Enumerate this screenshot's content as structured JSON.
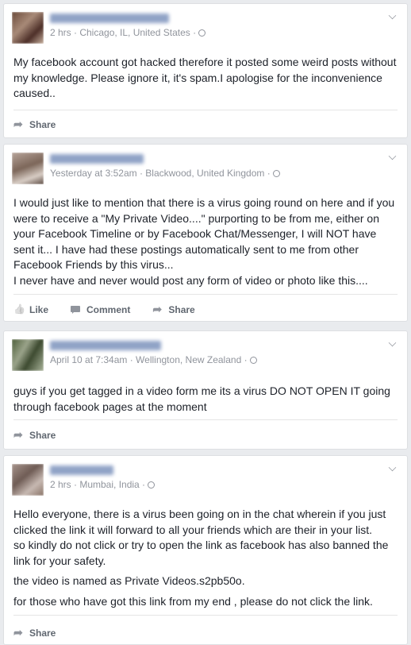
{
  "posts": [
    {
      "meta": "2 hrs · Chicago, IL, United States ·",
      "body": [
        "My facebook account got hacked therefore it posted some weird posts without my knowledge. Please ignore it, it's spam.I apologise for the inconvenience caused.."
      ],
      "actions": {
        "share": "Share"
      }
    },
    {
      "meta": "Yesterday at 3:52am · Blackwood, United Kingdom ·",
      "body": [
        "I would just like to mention that there is a virus going round on here and if you were to receive a \"My Private Video....\" purporting to be from me, either on your Facebook Timeline or by Facebook Chat/Messenger, I will NOT have sent it... I have had these postings automatically sent to me from other Facebook Friends by this virus...",
        "I never have and never would post any form of video or photo like this...."
      ],
      "actions": {
        "like": "Like",
        "comment": "Comment",
        "share": "Share"
      }
    },
    {
      "meta": "April 10 at 7:34am · Wellington, New Zealand ·",
      "body": [
        "guys if you get tagged in a video form me its a virus DO NOT OPEN IT going through facebook pages at the moment"
      ],
      "actions": {
        "share": "Share"
      }
    },
    {
      "meta": "2 hrs · Mumbai, India ·",
      "body": [
        "Hello everyone, there is a virus been going on in the chat wherein if you just clicked the link it will forward to all your friends which are their in your list.",
        "so kindly do not click or try to open the link as facebook has also banned the link for your safety.",
        "the video is named as Private Videos.s2pb50o.",
        "for those who have got this link from my end , please do not click the link."
      ],
      "actions": {
        "share": "Share"
      }
    }
  ],
  "icons": {
    "options": "chevron-down-icon",
    "audience": "globe-icon",
    "share": "share-arrow-icon",
    "like": "thumbs-up-icon",
    "comment": "speech-bubble-icon"
  },
  "colors": {
    "background": "#e9ebee",
    "card": "#ffffff",
    "meta": "#90949c",
    "action": "#606770"
  }
}
